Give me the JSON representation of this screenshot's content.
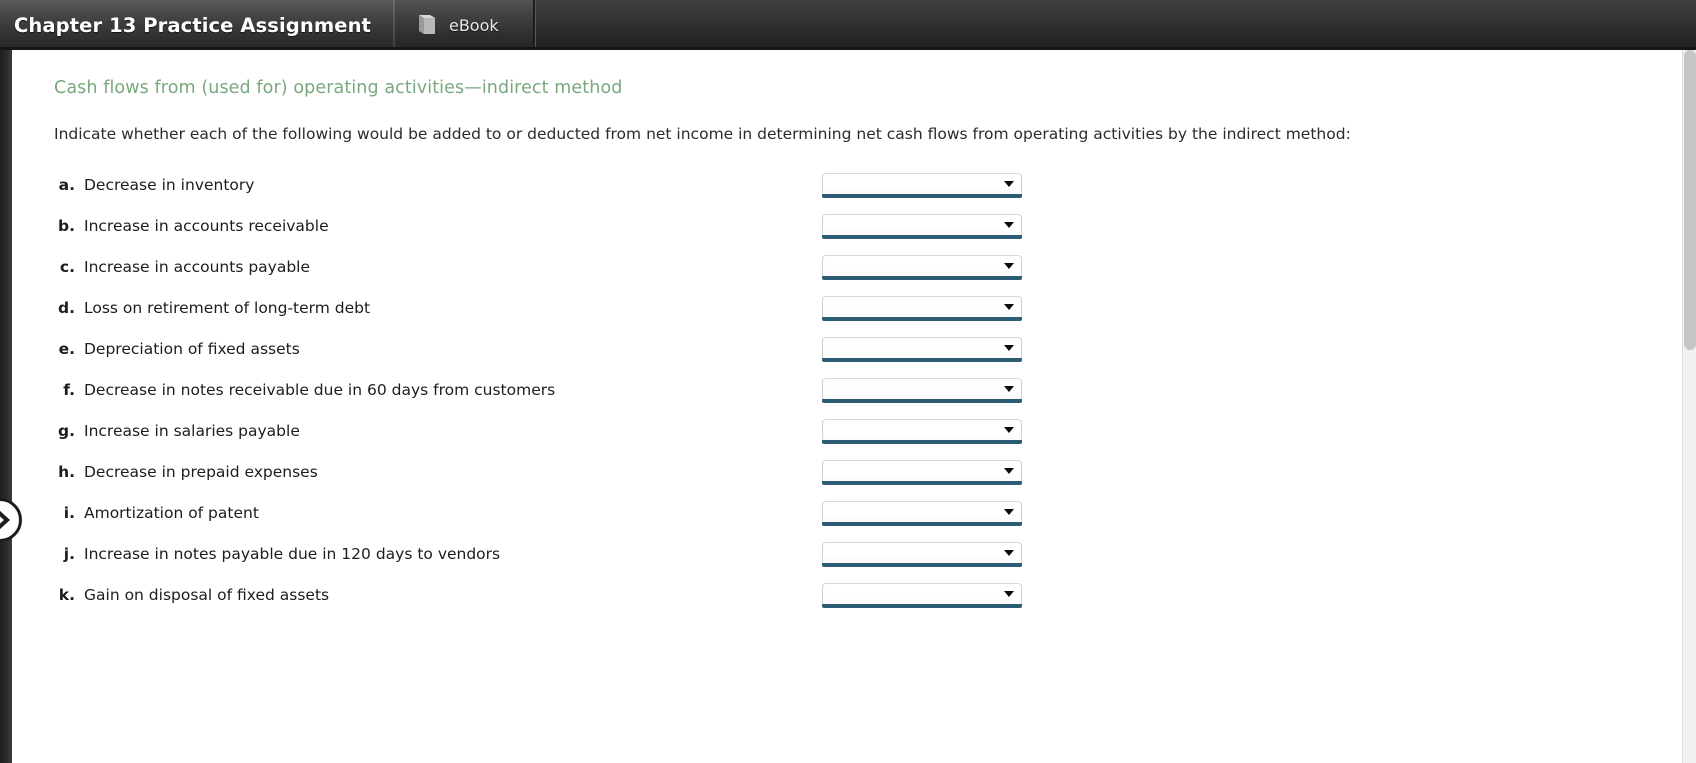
{
  "topbar": {
    "assignment_title": "Chapter 13 Practice Assignment",
    "ebook_tab_label": "eBook",
    "book_icon": "book-icon"
  },
  "rail": {
    "expander_icon": "chevron-right-icon"
  },
  "content": {
    "section_heading": "Cash flows from (used for) operating activities—indirect method",
    "instruction": "Indicate whether each of the following would be added to or deducted from net income in determining net cash flows from operating activities by the indirect method:",
    "items": [
      {
        "marker": "a.",
        "label": "Decrease in inventory",
        "value": ""
      },
      {
        "marker": "b.",
        "label": "Increase in accounts receivable",
        "value": ""
      },
      {
        "marker": "c.",
        "label": "Increase in accounts payable",
        "value": ""
      },
      {
        "marker": "d.",
        "label": "Loss on retirement of long-term debt",
        "value": ""
      },
      {
        "marker": "e.",
        "label": "Depreciation of fixed assets",
        "value": ""
      },
      {
        "marker": "f.",
        "label": "Decrease in notes receivable due in 60 days from customers",
        "value": ""
      },
      {
        "marker": "g.",
        "label": "Increase in salaries payable",
        "value": ""
      },
      {
        "marker": "h.",
        "label": "Decrease in prepaid expenses",
        "value": ""
      },
      {
        "marker": "i.",
        "label": "Amortization of patent",
        "value": ""
      },
      {
        "marker": "j.",
        "label": "Increase in notes payable due in 120 days to vendors",
        "value": ""
      },
      {
        "marker": "k.",
        "label": "Gain on disposal of fixed assets",
        "value": ""
      }
    ]
  },
  "colors": {
    "heading_green": "#7aa87e",
    "select_underline": "#2d5d75",
    "topbar_dark": "#2e2e2e"
  }
}
